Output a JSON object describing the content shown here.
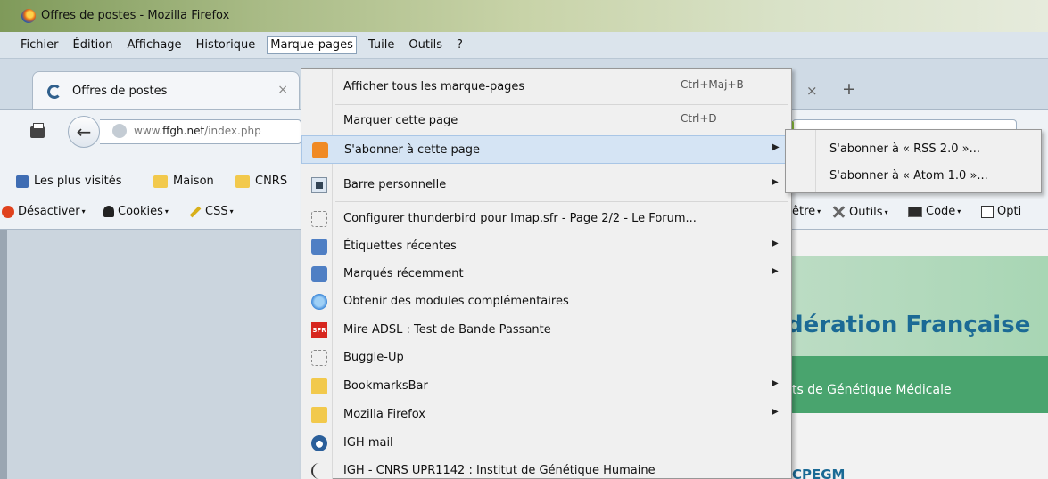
{
  "window": {
    "title": "Offres de postes - Mozilla Firefox"
  },
  "menubar": [
    {
      "label": "Fichier"
    },
    {
      "label": "Édition"
    },
    {
      "label": "Affichage"
    },
    {
      "label": "Historique"
    },
    {
      "label": "Marque-pages",
      "active": true
    },
    {
      "label": "Tuile"
    },
    {
      "label": "Outils"
    },
    {
      "label": "?"
    }
  ],
  "tab": {
    "label": "Offres de postes",
    "close": "×"
  },
  "tabstrip": {
    "close_right": "×",
    "new_tab": "+"
  },
  "navigation": {
    "url_domain": "www.",
    "url_host": "ffgh.net",
    "url_path": "/index.php"
  },
  "bookmarks_bar": [
    {
      "label": "Les plus visités",
      "icon": "most-visited-icon"
    },
    {
      "label": "Maison",
      "icon": "folder-icon"
    },
    {
      "label": "CNRS",
      "icon": "folder-icon"
    }
  ],
  "webdev_bar": [
    {
      "label": "Désactiver",
      "icon": "disable-icon"
    },
    {
      "label": "Cookies",
      "icon": "cookies-icon"
    },
    {
      "label": "CSS",
      "icon": "css-icon"
    },
    {
      "label": "être",
      "icon": ""
    },
    {
      "label": "Outils",
      "icon": "tools-icon"
    },
    {
      "label": "Code",
      "icon": "code-icon"
    },
    {
      "label": "Opti",
      "icon": "options-icon"
    }
  ],
  "bookmarks_menu": {
    "items": [
      {
        "label": "Afficher tous les marque-pages",
        "shortcut": "Ctrl+Maj+B"
      },
      {
        "label": "Marquer cette page",
        "shortcut": "Ctrl+D"
      },
      {
        "label": "S'abonner à cette page",
        "icon": "rss-icon",
        "submenu": true,
        "highlighted": true
      },
      {
        "label": "Barre personnelle",
        "icon": "toolbar-icon",
        "submenu": true
      },
      {
        "label": "Configurer thunderbird pour Imap.sfr - Page 2/2 - Le Forum...",
        "icon": "page-icon"
      },
      {
        "label": "Étiquettes récentes",
        "icon": "tags-icon",
        "submenu": true
      },
      {
        "label": "Marqués récemment",
        "icon": "recent-icon",
        "submenu": true
      },
      {
        "label": "Obtenir des modules complémentaires",
        "icon": "addons-icon"
      },
      {
        "label": "Mire ADSL : Test de Bande Passante",
        "icon": "sfr-icon"
      },
      {
        "label": "Buggle-Up",
        "icon": "page-icon"
      },
      {
        "label": "BookmarksBar",
        "icon": "folder-icon",
        "submenu": true
      },
      {
        "label": "Mozilla Firefox",
        "icon": "folder-icon",
        "submenu": true
      },
      {
        "label": "IGH mail",
        "icon": "mail-icon"
      },
      {
        "label": "IGH - CNRS UPR1142 : Institut de Génétique Humaine",
        "icon": "dna-icon"
      }
    ],
    "sfr_icon_text": "SFR",
    "submenu_arrow": "▶"
  },
  "subscribe_submenu": [
    {
      "label": "S'abonner à « RSS 2.0 »..."
    },
    {
      "label": "S'abonner à « Atom 1.0 »..."
    }
  ],
  "page": {
    "title_fragment": "dération Française",
    "subtitle_fragment": "ts de Génétique Médicale",
    "footer_fragment": "CPEGM"
  },
  "colors": {
    "highlight": "#d5e4f4",
    "rss": "#f08a24",
    "page_title": "#1b6a95",
    "page_green": "#49a46e"
  }
}
